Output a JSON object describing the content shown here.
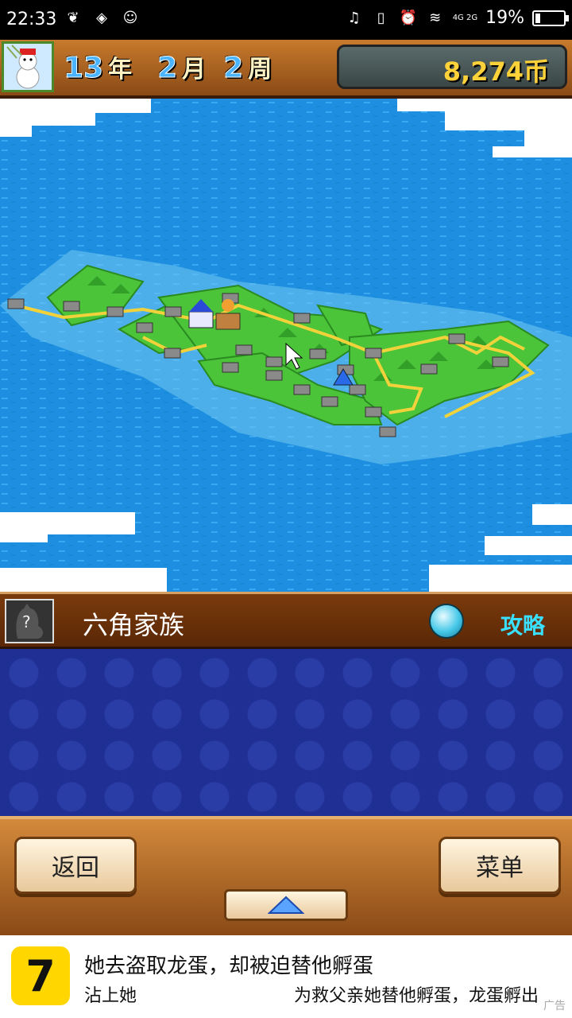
{
  "status_bar": {
    "time": "22:33",
    "network": "4G 2G",
    "battery_percent": "19%",
    "battery_level": 0.19
  },
  "header": {
    "year": "13",
    "year_unit": "年",
    "month": "2",
    "month_unit": "月",
    "week": "2",
    "week_unit": "周",
    "coins": "8,274币"
  },
  "info_bar": {
    "family_name": "六角家族",
    "guide_label": "攻略"
  },
  "controls": {
    "back_label": "返回",
    "menu_label": "菜单"
  },
  "ad": {
    "title": "她去盗取龙蛋，却被迫替他孵蛋",
    "line_left": "沾上她",
    "line_right": "为救父亲她替他孵蛋，龙蛋孵出",
    "tag": "广告"
  },
  "colors": {
    "ocean": "#1e8fe0",
    "land": "#4cc43a",
    "road": "#f2d23a",
    "panel": "#1f2f94"
  }
}
